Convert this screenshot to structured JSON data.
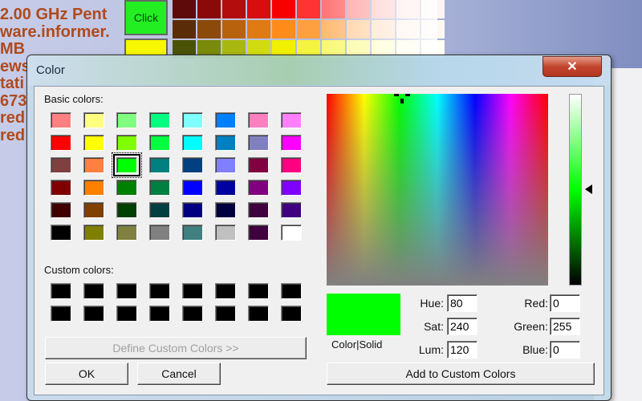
{
  "background": {
    "text_lines": [
      "2.00 GHz Pent",
      "ware.informer.",
      "MB",
      "ews",
      "tati",
      "673",
      "red",
      "red"
    ],
    "click_button_label": "Click",
    "palette_colors": [
      [
        "#5e0a0a",
        "#8a0a0a",
        "#b30d0d",
        "#d80d0d",
        "#f80000",
        "#ff3333",
        "#ff7070",
        "#ffa0a0",
        "#ffc8c8",
        "#ffe4e4",
        "#fff4f4"
      ],
      [
        "#5a2d08",
        "#8c4a0a",
        "#b8620d",
        "#e07a12",
        "#ff8c1a",
        "#ffa040",
        "#ffb870",
        "#ffd0a0",
        "#ffe2c8",
        "#fff0e4",
        "#fff8f2"
      ],
      [
        "#4a5208",
        "#7a8a0a",
        "#a8b810",
        "#d0dc10",
        "#f0f000",
        "#f4f440",
        "#f8f870",
        "#fbfba0",
        "#fdfdc8",
        "#fefee4",
        "#fffff4"
      ]
    ]
  },
  "dialog": {
    "title": "Color",
    "close_label": "✕",
    "basic_colors_label": "Basic colors:",
    "basic_colors": [
      [
        "#ff8080",
        "#ffff80",
        "#80ff80",
        "#00ff80",
        "#80ffff",
        "#0080ff",
        "#ff80c0",
        "#ff80ff"
      ],
      [
        "#ff0000",
        "#ffff00",
        "#80ff00",
        "#00ff40",
        "#00ffff",
        "#0080c0",
        "#8080c0",
        "#ff00ff"
      ],
      [
        "#804040",
        "#ff8040",
        "#00ff00",
        "#008080",
        "#004080",
        "#8080ff",
        "#800040",
        "#ff0080"
      ],
      [
        "#800000",
        "#ff8000",
        "#008000",
        "#008040",
        "#0000ff",
        "#0000a0",
        "#800080",
        "#8000ff"
      ],
      [
        "#400000",
        "#804000",
        "#004000",
        "#004040",
        "#000080",
        "#000040",
        "#400040",
        "#400080"
      ],
      [
        "#000000",
        "#808000",
        "#808040",
        "#808080",
        "#408080",
        "#c0c0c0",
        "#400040",
        "#ffffff"
      ]
    ],
    "selected_basic": {
      "row": 2,
      "col": 2
    },
    "custom_colors_label": "Custom colors:",
    "custom_colors": [
      [
        "#000000",
        "#000000",
        "#000000",
        "#000000",
        "#000000",
        "#000000",
        "#000000",
        "#000000"
      ],
      [
        "#000000",
        "#000000",
        "#000000",
        "#000000",
        "#000000",
        "#000000",
        "#000000",
        "#000000"
      ]
    ],
    "define_custom_label": "Define Custom Colors >>",
    "ok_label": "OK",
    "cancel_label": "Cancel",
    "preview_color": "#00ff00",
    "color_solid_label": "Color|Solid",
    "fields": {
      "hue": {
        "label": "Hue:",
        "value": "80"
      },
      "sat": {
        "label": "Sat:",
        "value": "240"
      },
      "lum": {
        "label": "Lum:",
        "value": "120"
      },
      "red": {
        "label": "Red:",
        "value": "0"
      },
      "green": {
        "label": "Green:",
        "value": "255"
      },
      "blue": {
        "label": "Blue:",
        "value": "0"
      }
    },
    "add_custom_label": "Add to Custom Colors"
  }
}
